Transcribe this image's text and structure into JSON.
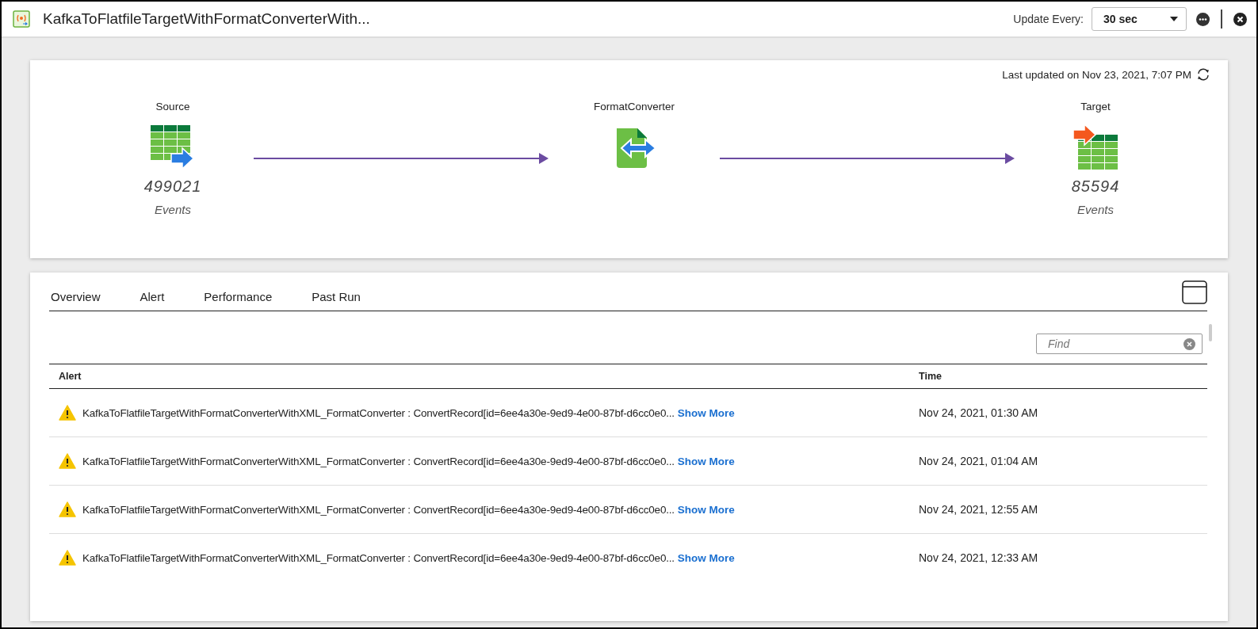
{
  "header": {
    "title": "KafkaToFlatfileTargetWithFormatConverterWith...",
    "update_label": "Update Every:",
    "update_value": "30 sec"
  },
  "flow": {
    "last_updated": "Last updated on Nov 23, 2021, 7:07 PM",
    "nodes": [
      {
        "kind": "source",
        "label": "Source",
        "count": "499021",
        "unit": "Events"
      },
      {
        "kind": "converter",
        "label": "FormatConverter"
      },
      {
        "kind": "target",
        "label": "Target",
        "count": "85594",
        "unit": "Events"
      }
    ]
  },
  "tabs": [
    "Overview",
    "Alert",
    "Performance",
    "Past Run"
  ],
  "search": {
    "placeholder": "Find"
  },
  "table": {
    "columns": [
      "Alert",
      "Time"
    ],
    "rows": [
      {
        "message": "KafkaToFlatfileTargetWithFormatConverterWithXML_FormatConverter : ConvertRecord[id=6ee4a30e-9ed9-4e00-87bf-d6cc0e0...",
        "link": "Show More",
        "time": "Nov 24, 2021, 01:30 AM"
      },
      {
        "message": "KafkaToFlatfileTargetWithFormatConverterWithXML_FormatConverter : ConvertRecord[id=6ee4a30e-9ed9-4e00-87bf-d6cc0e0...",
        "link": "Show More",
        "time": "Nov 24, 2021, 01:04 AM"
      },
      {
        "message": "KafkaToFlatfileTargetWithFormatConverterWithXML_FormatConverter : ConvertRecord[id=6ee4a30e-9ed9-4e00-87bf-d6cc0e0...",
        "link": "Show More",
        "time": "Nov 24, 2021, 12:55 AM"
      },
      {
        "message": "KafkaToFlatfileTargetWithFormatConverterWithXML_FormatConverter : ConvertRecord[id=6ee4a30e-9ed9-4e00-87bf-d6cc0e0...",
        "link": "Show More",
        "time": "Nov 24, 2021, 12:33 AM"
      }
    ]
  }
}
